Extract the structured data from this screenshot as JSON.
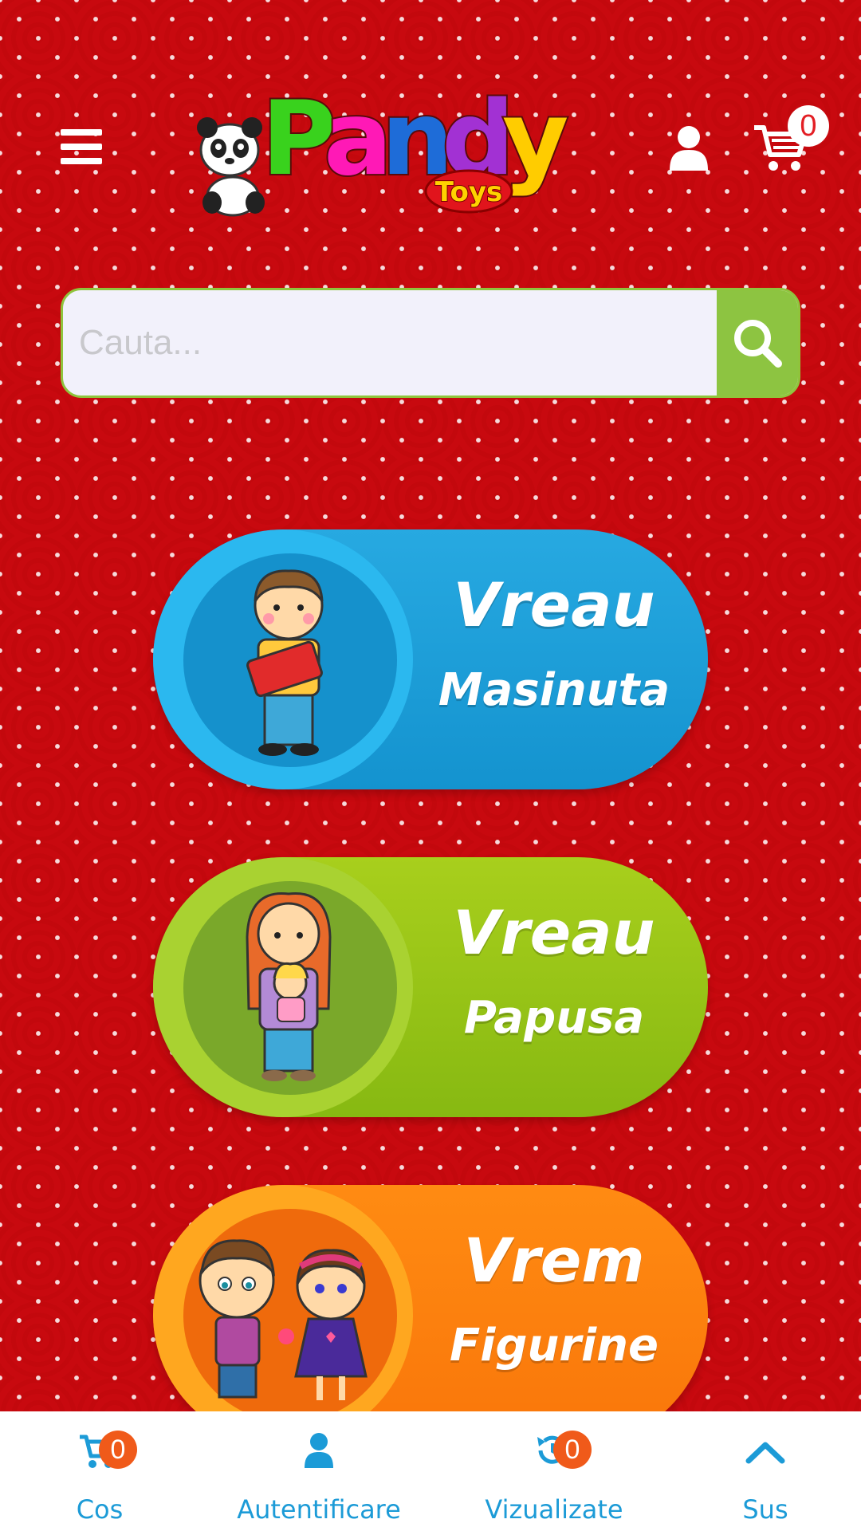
{
  "header": {
    "logo_text": "Pandy",
    "logo_subtext": "Toys",
    "cart_count": "0"
  },
  "search": {
    "placeholder": "Cauta..."
  },
  "categories": [
    {
      "line1": "Vreau",
      "line2": "Masinuta",
      "color": "#1493cf"
    },
    {
      "line1": "Vreau",
      "line2": "Papusa",
      "color": "#87b912"
    },
    {
      "line1": "Vrem",
      "line2": "Figurine",
      "color": "#f9760a"
    }
  ],
  "bottom_nav": {
    "cart_label": "Cos",
    "cart_count": "0",
    "login_label": "Autentificare",
    "viewed_label": "Vizualizate",
    "viewed_count": "0",
    "top_label": "Sus"
  },
  "colors": {
    "background": "#c8090f",
    "accent_blue": "#1c9bd7",
    "accent_green": "#8dc441",
    "badge_orange": "#f05a1a"
  }
}
